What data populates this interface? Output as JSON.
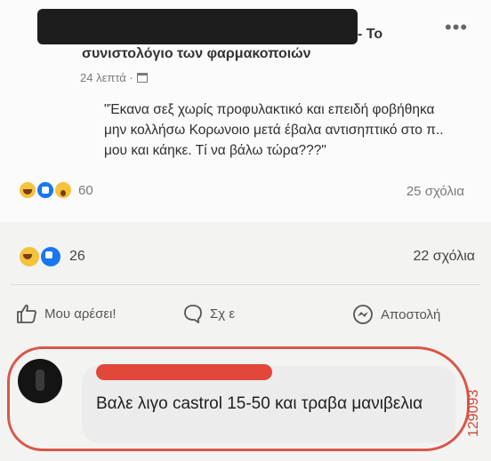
{
  "shared_post": {
    "title_suffix": "- Το",
    "title_line2": "συνιστολόγιο των φαρμακοποιών",
    "timestamp": "24 λεπτά ·",
    "more_icon": "more-dots-icon",
    "quote": "\"Έκανα σεξ χωρίς προφυλακτικό και επειδή φοβήθηκα μην κολλήσω Κορωνοιο μετά έβαλα αντισηπτικό στο π.. μου και κάηκε. Τί να βάλω τώρα???\"",
    "reaction_count": "60",
    "comments": "25 σχόλια"
  },
  "post": {
    "reaction_count": "26",
    "comments": "22 σχόλια"
  },
  "actions": {
    "like_label": "Μου αρέσει!",
    "comment_label": "Σχ      ε",
    "send_label": "Αποστολή"
  },
  "comment": {
    "text": "Βαλε λιγο castrol 15-50 και τραβα μανιβελια"
  },
  "watermark": "129093",
  "colors": {
    "highlight_red": "#d8574c",
    "like_blue": "#1877f2"
  }
}
